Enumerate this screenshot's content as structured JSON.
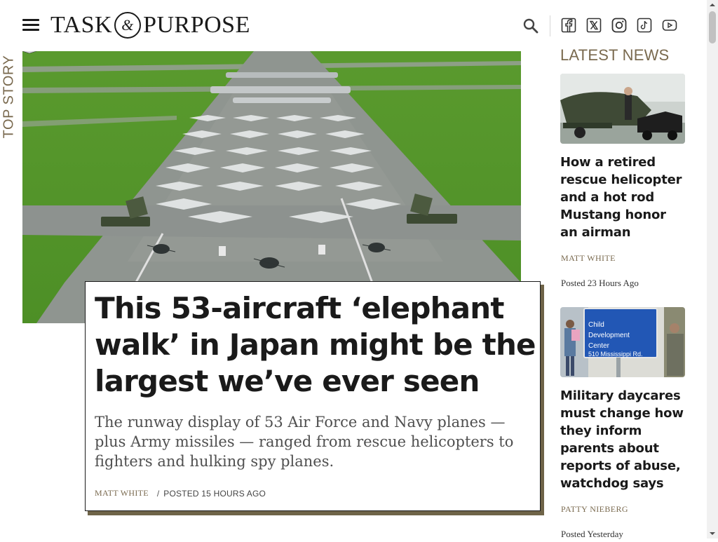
{
  "header": {
    "logo_left": "TASK",
    "logo_amp": "&",
    "logo_right": "PURPOSE",
    "social": [
      "facebook-icon",
      "x-icon",
      "instagram-icon",
      "tiktok-icon",
      "youtube-icon"
    ]
  },
  "top_story": {
    "label": "TOP STORY",
    "headline": "This 53-aircraft ‘elephant walk’ in Japan might be the largest we’ve ever seen",
    "dek": "The runway display of 53 Air Force and Navy planes — plus Army missiles — ranged from rescue helicopters to fighters and hulking spy planes.",
    "author": "MATT WHITE",
    "separator": "/",
    "posted": "POSTED 15 HOURS AGO"
  },
  "latest_news": {
    "title": "LATEST NEWS",
    "items": [
      {
        "title": "How a retired rescue helicopter and a hot rod Mustang honor an airman",
        "author": "MATT WHITE",
        "posted": "Posted 23 Hours Ago"
      },
      {
        "title": "Military daycares must change how they inform parents about reports of abuse, watchdog says",
        "author": "PATTY NIEBERG",
        "posted": "Posted Yesterday",
        "sign_lines": [
          "Child",
          "Development",
          "Center",
          "510 Mississippi Rd."
        ]
      }
    ]
  },
  "colors": {
    "accent": "#7a6a4f",
    "text": "#1a1a1a",
    "shadow": "#6f6448"
  }
}
